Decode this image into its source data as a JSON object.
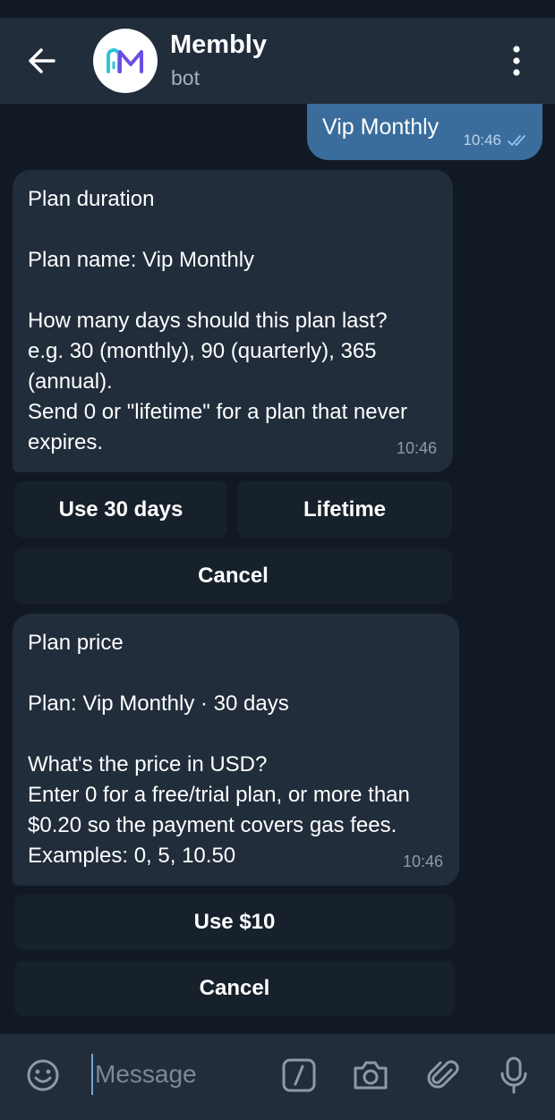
{
  "header": {
    "title": "Membly",
    "subtitle": "bot"
  },
  "outgoing": {
    "text": "Vip Monthly",
    "time": "10:46"
  },
  "messages": [
    {
      "lines": [
        "Plan duration",
        "",
        "Plan name: Vip Monthly",
        "",
        "How many days should this plan last?",
        "e.g. 30 (monthly), 90 (quarterly), 365",
        "(annual).",
        "Send 0 or \"lifetime\" for a plan that never",
        "expires."
      ],
      "time": "10:46",
      "buttons": [
        {
          "label": "Use 30 days"
        },
        {
          "label": "Lifetime"
        },
        {
          "label": "Cancel"
        }
      ]
    },
    {
      "lines": [
        "Plan price",
        "",
        "Plan: Vip Monthly · 30 days",
        "",
        "What's the price in USD?",
        "Enter 0 for a free/trial plan, or more than",
        "$0.20 so the payment covers gas fees.",
        "Examples: 0, 5, 10.50"
      ],
      "time": "10:46",
      "buttons": [
        {
          "label": "Use $10"
        },
        {
          "label": "Cancel"
        }
      ]
    }
  ],
  "composer": {
    "placeholder": "Message"
  },
  "colors": {
    "background": "#111a24",
    "header": "#212d3b",
    "bubble_in": "#212d3b",
    "bubble_out": "#3a6d9c",
    "keyboard_button": "#17212b",
    "accent": "#6fa5d6"
  }
}
